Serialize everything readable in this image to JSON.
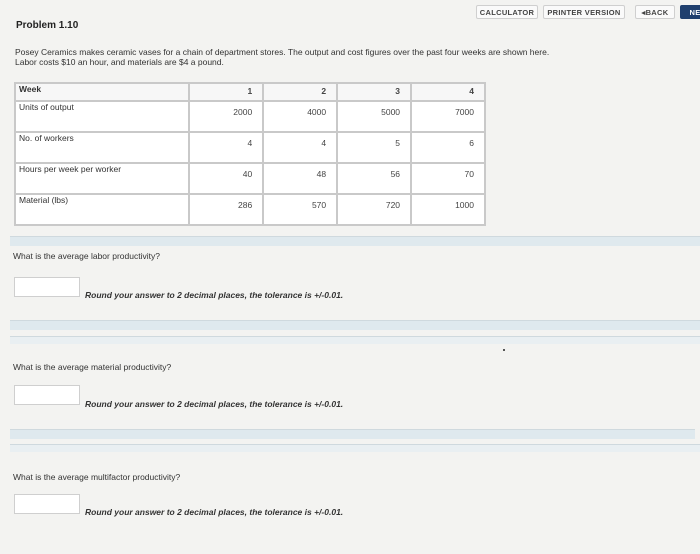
{
  "nav": {
    "calculator": "CALCULATOR",
    "printer_version": "PRINTER VERSION",
    "back": "BACK",
    "next": "NE"
  },
  "problem": {
    "title": "Problem 1.10",
    "intro_line1": "Posey Ceramics makes ceramic vases for a chain of department stores. The output and cost figures over the past four weeks are shown here.",
    "intro_line2": "Labor costs $10 an hour, and materials are $4 a pound."
  },
  "table": {
    "header": {
      "label": "Week",
      "values": [
        "1",
        "2",
        "3",
        "4"
      ]
    },
    "rows": [
      {
        "label": "Units of output",
        "values": [
          "2000",
          "4000",
          "5000",
          "7000"
        ]
      },
      {
        "label": "No. of workers",
        "values": [
          "4",
          "4",
          "5",
          "6"
        ]
      },
      {
        "label": "Hours per week per worker",
        "values": [
          "40",
          "48",
          "56",
          "70"
        ]
      },
      {
        "label": "Material (lbs)",
        "values": [
          "286",
          "570",
          "720",
          "1000"
        ]
      }
    ]
  },
  "questions": [
    {
      "text": "What is the average labor productivity?",
      "answer": "",
      "hint": "Round your answer to 2 decimal places, the tolerance is +/-0.01."
    },
    {
      "text": "What is the average material productivity?",
      "answer": "",
      "hint": "Round your answer to 2 decimal places, the tolerance is +/-0.01."
    },
    {
      "text": "What is the average multifactor productivity?",
      "answer": "",
      "hint": "Round your answer to 2 decimal places, the tolerance is +/-0.01."
    }
  ]
}
